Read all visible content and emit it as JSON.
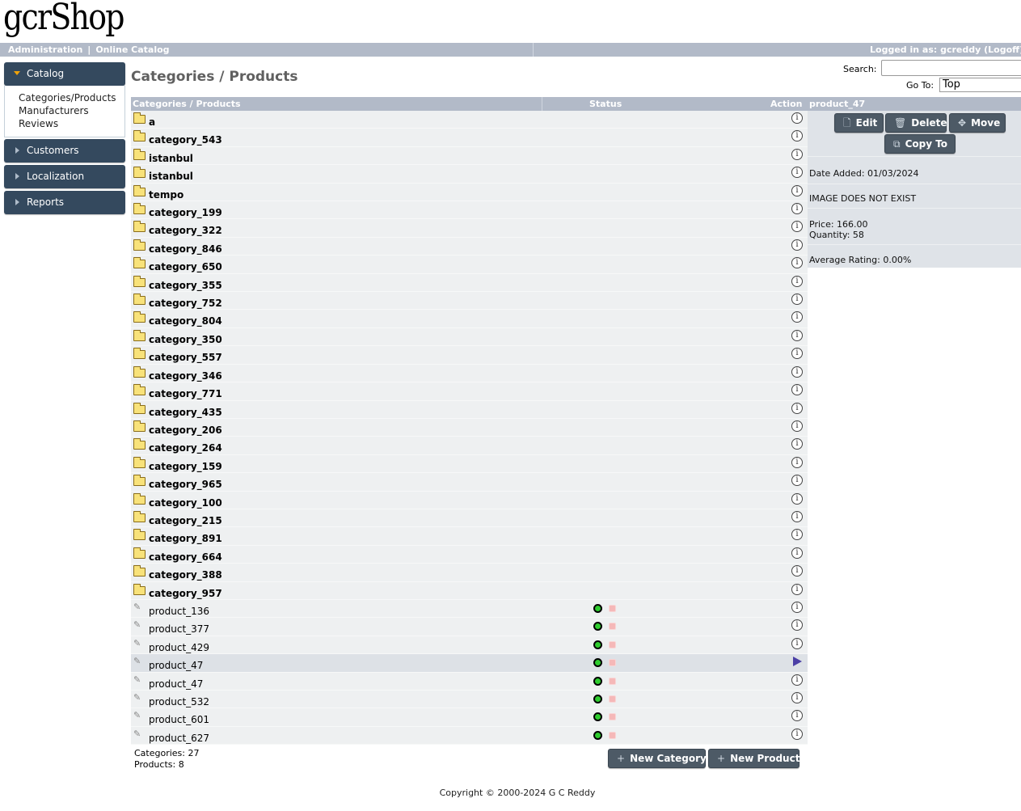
{
  "app": {
    "logo": "gcrShop"
  },
  "topbar": {
    "admin_link": "Administration",
    "separator": "|",
    "catalog_link": "Online Catalog",
    "logged_in": "Logged in as: gcreddy (Logoff)"
  },
  "sidebar": {
    "sections": [
      {
        "label": "Catalog",
        "expanded": true
      },
      {
        "label": "Customers",
        "expanded": false
      },
      {
        "label": "Localization",
        "expanded": false
      },
      {
        "label": "Reports",
        "expanded": false
      }
    ],
    "catalog_items": [
      "Categories/Products",
      "Manufacturers",
      "Reviews"
    ]
  },
  "page": {
    "title": "Categories / Products",
    "search_label": "Search:",
    "search_value": "",
    "goto_label": "Go To:",
    "goto_value": "Top"
  },
  "table": {
    "headers": {
      "name": "Categories / Products",
      "status": "Status",
      "action": "Action"
    },
    "categories": [
      "a",
      "category_543",
      "istanbul",
      "istanbul",
      "tempo",
      "category_199",
      "category_322",
      "category_846",
      "category_650",
      "category_355",
      "category_752",
      "category_804",
      "category_350",
      "category_557",
      "category_346",
      "category_771",
      "category_435",
      "category_206",
      "category_264",
      "category_159",
      "category_965",
      "category_100",
      "category_215",
      "category_891",
      "category_664",
      "category_388",
      "category_957"
    ],
    "products": [
      "product_136",
      "product_377",
      "product_429",
      "product_47",
      "product_47",
      "product_532",
      "product_601",
      "product_627"
    ],
    "selected_product_index": 3
  },
  "counts": {
    "categories": "Categories: 27",
    "products": "Products: 8"
  },
  "buttons": {
    "new_category": "New Category",
    "new_product": "New Product"
  },
  "info_panel": {
    "title": "product_47",
    "edit": "Edit",
    "delete": "Delete",
    "move": "Move",
    "copy_to": "Copy To",
    "date_added": "Date Added: 01/03/2024",
    "image": "IMAGE DOES NOT EXIST",
    "price": "Price: 166.00",
    "quantity": "Quantity: 58",
    "rating": "Average Rating: 0.00%"
  },
  "footer": "Copyright © 2000-2024 G C Reddy",
  "colors": {
    "header_bar": "#b2bac8",
    "sidebar_head": "#34495e",
    "status_active": "#2fcc2f",
    "status_inactive": "#f5b8b8"
  }
}
